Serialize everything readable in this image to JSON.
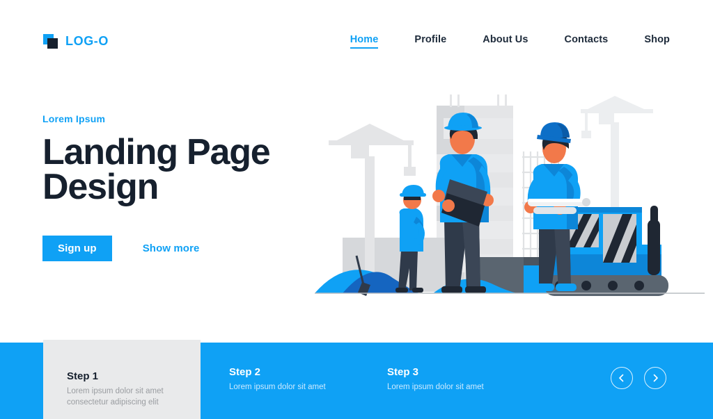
{
  "header": {
    "brand": {
      "text": "LOG-O",
      "mark_icon": "logo-square-icon",
      "color": "#0fa1f5"
    },
    "nav": [
      {
        "label": "Home",
        "active": true
      },
      {
        "label": "Profile",
        "active": false
      },
      {
        "label": "About Us",
        "active": false
      },
      {
        "label": "Contacts",
        "active": false
      },
      {
        "label": "Shop",
        "active": false
      }
    ]
  },
  "hero": {
    "eyebrow": "Lorem Ipsum",
    "title": "Landing Page\nDesign",
    "primary_button": "Sign up",
    "secondary_link": "Show more"
  },
  "illustration": {
    "alt": "construction-site-illustration",
    "colors": {
      "blue": "#0fa1f5",
      "blue_dark": "#0a6fc2",
      "blue_deep": "#1565c0",
      "navy": "#2f3a4a",
      "navy_dark": "#1f2733",
      "skin": "#f2794a",
      "skin_dark": "#e06a3f",
      "gray_light": "#e4e5e7",
      "gray_mid": "#cfd2d6",
      "gray_dark": "#5a6570",
      "white": "#ffffff"
    }
  },
  "steps": {
    "band_color": "#0fa1f5",
    "items": [
      {
        "title": "Step 1",
        "desc": "Lorem ipsum dolor sit amet\nconsectetur adipiscing elit",
        "featured": true
      },
      {
        "title": "Step 2",
        "desc": "Lorem ipsum dolor sit amet",
        "featured": false
      },
      {
        "title": "Step 3",
        "desc": "Lorem ipsum dolor sit amet",
        "featured": false
      }
    ],
    "prev_icon": "chevron-left-icon",
    "next_icon": "chevron-right-icon"
  }
}
